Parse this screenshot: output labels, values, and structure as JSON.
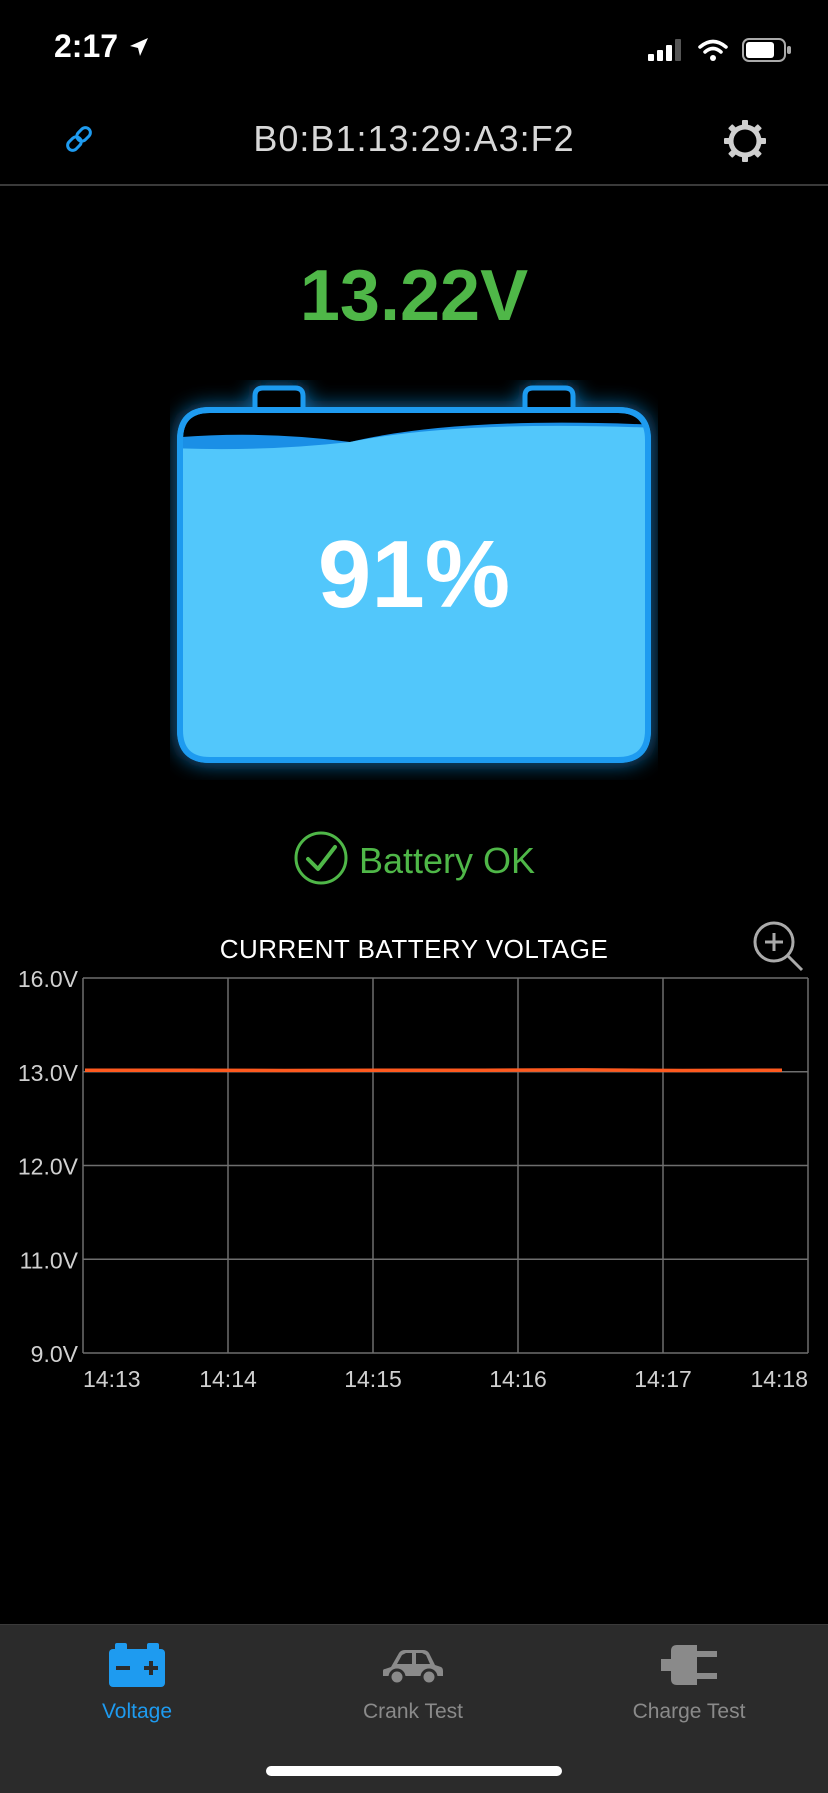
{
  "status_bar": {
    "time": "2:17"
  },
  "header": {
    "title": "B0:B1:13:29:A3:F2"
  },
  "battery": {
    "voltage": "13.22V",
    "percent_label": "91%",
    "charge_fraction": 0.91,
    "status": "Battery OK"
  },
  "colors": {
    "accent": "#1e9bf0",
    "ok_green": "#4fb748",
    "battery_fill": "#52c7fb",
    "series": "#ff5a1f"
  },
  "chart_data": {
    "type": "line",
    "title": "CURRENT BATTERY VOLTAGE",
    "x_ticks": [
      "14:13",
      "14:14",
      "14:15",
      "14:16",
      "14:17",
      "14:18"
    ],
    "y_ticks": [
      "9.0V",
      "11.0V",
      "12.0V",
      "13.0V",
      "16.0V"
    ],
    "y_tick_values": [
      9,
      11,
      12,
      13,
      16
    ],
    "series": [
      {
        "values": [
          13.05,
          13.05,
          13.04,
          13.05,
          13.05,
          13.06,
          13.04,
          13.05
        ]
      }
    ],
    "grid": true
  },
  "tabs": [
    {
      "label": "Voltage",
      "icon": "battery-icon",
      "active": true
    },
    {
      "label": "Crank Test",
      "icon": "car-icon",
      "active": false
    },
    {
      "label": "Charge Test",
      "icon": "plug-icon",
      "active": false
    }
  ]
}
